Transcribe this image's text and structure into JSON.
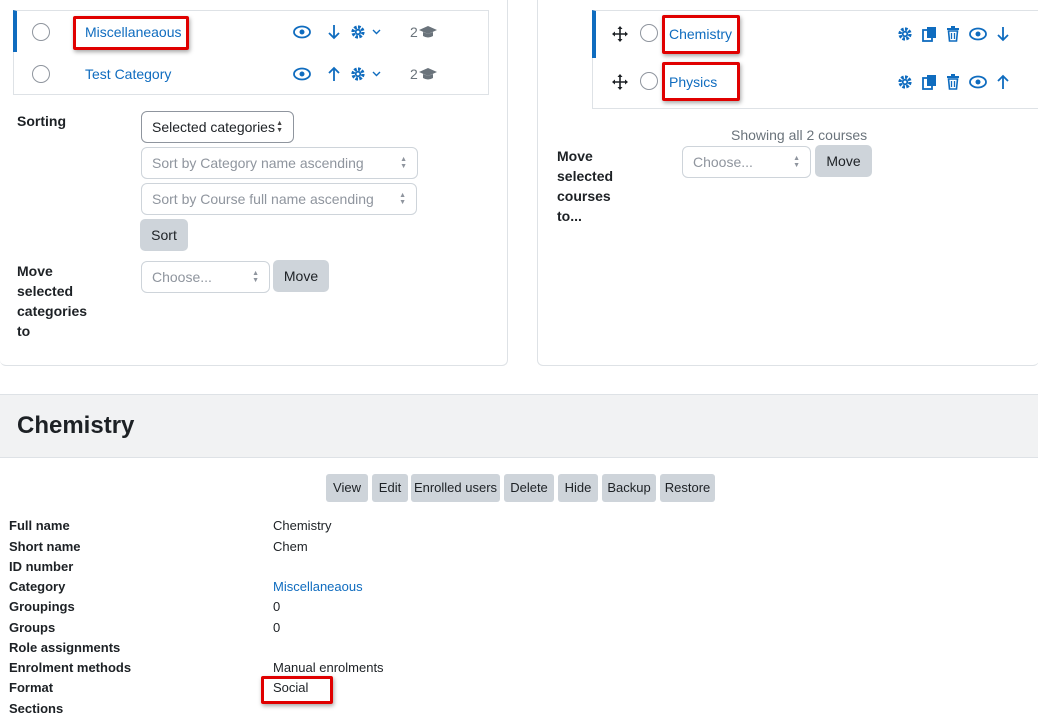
{
  "categories": {
    "rows": [
      {
        "name": "Miscellaneaous",
        "count": "2"
      },
      {
        "name": "Test Category",
        "count": "2"
      }
    ],
    "sorting_label": "Sorting",
    "sort_scope": "Selected categories",
    "sort_category_placeholder": "Sort by Category name ascending",
    "sort_course_placeholder": "Sort by Course full name ascending",
    "sort_button": "Sort",
    "move_label": "Move selected categories to",
    "move_placeholder": "Choose...",
    "move_button": "Move"
  },
  "courses": {
    "rows": [
      {
        "name": "Chemistry"
      },
      {
        "name": "Physics"
      }
    ],
    "showing_text": "Showing all 2 courses",
    "move_label": "Move selected courses to...",
    "move_placeholder": "Choose...",
    "move_button": "Move"
  },
  "detail": {
    "title": "Chemistry",
    "actions": [
      "View",
      "Edit",
      "Enrolled users",
      "Delete",
      "Hide",
      "Backup",
      "Restore"
    ],
    "fields": [
      {
        "label": "Full name",
        "value": "Chemistry"
      },
      {
        "label": "Short name",
        "value": "Chem"
      },
      {
        "label": "ID number",
        "value": ""
      },
      {
        "label": "Category",
        "value": "Miscellaneaous"
      },
      {
        "label": "Groupings",
        "value": "0"
      },
      {
        "label": "Groups",
        "value": "0"
      },
      {
        "label": "Role assignments",
        "value": ""
      },
      {
        "label": "Enrolment methods",
        "value": "Manual enrolments"
      },
      {
        "label": "Format",
        "value": "Social"
      },
      {
        "label": "Sections",
        "value": ""
      }
    ]
  },
  "colors": {
    "link": "#0f6cbf",
    "highlight": "#e00000",
    "button": "#ced4da"
  }
}
